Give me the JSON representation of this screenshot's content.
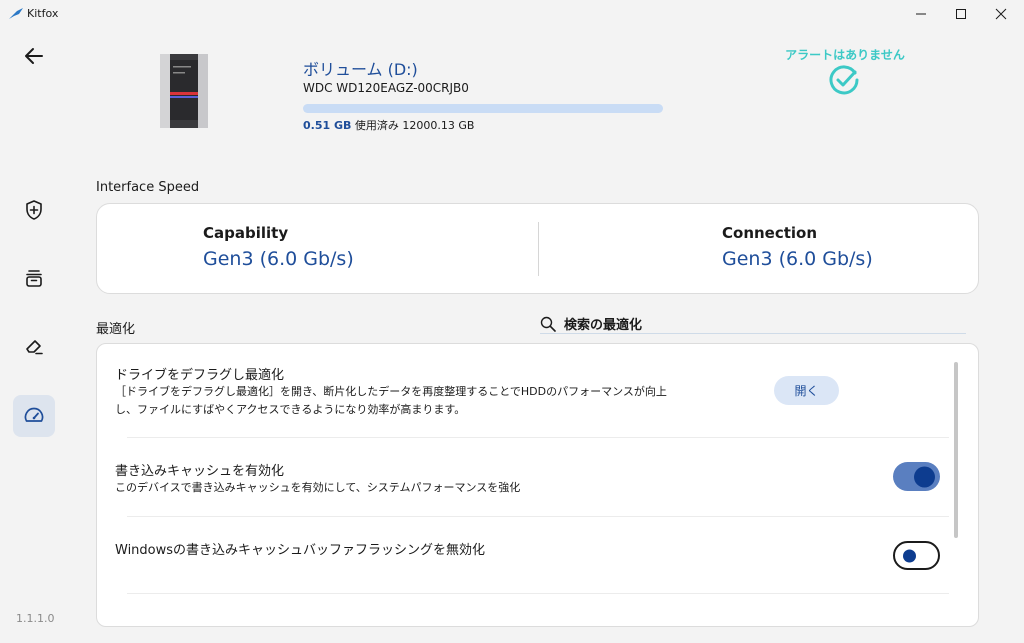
{
  "window": {
    "title": "Kitfox",
    "accent": "#1f4e9a",
    "alert_color": "#3cc9c6"
  },
  "nav": {
    "back_icon": "arrow-left-icon",
    "items": [
      {
        "name": "shield-plus-icon",
        "active": false
      },
      {
        "name": "archive-tray-icon",
        "active": false
      },
      {
        "name": "eraser-icon",
        "active": false
      },
      {
        "name": "speedometer-icon",
        "active": true
      }
    ],
    "version": "1.1.1.0"
  },
  "drive": {
    "title": "ボリューム (D:)",
    "model": "WDC WD120EAGZ-00CRJB0",
    "used": "0.51 GB",
    "used_label": "使用済み",
    "total": "12000.13 GB",
    "usage_fraction": 4.25e-05,
    "alert_text": "アラートはありません"
  },
  "interface_speed": {
    "label": "Interface Speed",
    "capability_label": "Capability",
    "capability_value": "Gen3 (6.0 Gb/s)",
    "connection_label": "Connection",
    "connection_value": "Gen3 (6.0 Gb/s)"
  },
  "optimization": {
    "label": "最適化",
    "search_label": "検索の最適化",
    "items": [
      {
        "title": "ドライブをデフラグし最適化",
        "description_line1": "［ドライブをデフラグし最適化］を開き、断片化したデータを再度整理することでHDDのパフォーマンスが向上",
        "description_line2": "し、ファイルにすばやくアクセスできるようになり効率が高まります。",
        "button_label": "開く"
      },
      {
        "title": "書き込みキャッシュを有効化",
        "description_line1": "このデバイスで書き込みキャッシュを有効にして、システムパフォーマンスを強化",
        "toggle_on": true
      },
      {
        "title": "Windowsの書き込みキャッシュバッファフラッシングを無効化",
        "toggle_on": false
      }
    ]
  }
}
